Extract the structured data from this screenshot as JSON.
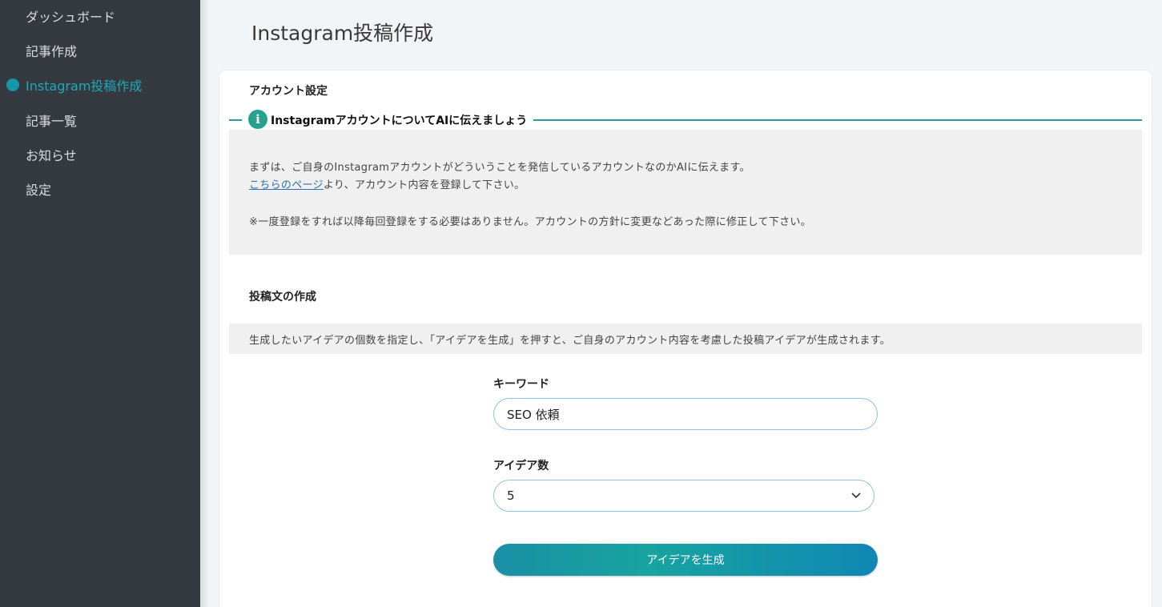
{
  "sidebar": {
    "items": [
      {
        "label": "ダッシュボード"
      },
      {
        "label": "記事作成"
      },
      {
        "label": "Instagram投稿作成"
      },
      {
        "label": "記事一覧"
      },
      {
        "label": "お知らせ"
      },
      {
        "label": "設定"
      }
    ],
    "active_color": "#1fa9b8",
    "background": "#343a40"
  },
  "page": {
    "title": "Instagram投稿作成"
  },
  "account_settings": {
    "heading": "アカウント設定",
    "info_title": "InstagramアカウントについてAIに伝えましょう",
    "info_icon": "info-icon",
    "line1": "まずは、ご自身のInstagramアカウントがどういうことを発信しているアカウントなのかAIに伝えます。",
    "link_text": "こちらのページ",
    "line2_rest": "より、アカウント内容を登録して下さい。",
    "note": "※一度登録をすれば以降毎回登録をする必要はありません。アカウントの方針に変更などあった際に修正して下さい。"
  },
  "post_creation": {
    "heading": "投稿文の作成",
    "hint": "生成したいアイデアの個数を指定し、「アイデアを生成」を押すと、ご自身のアカウント内容を考慮した投稿アイデアが生成されます。",
    "keyword_label": "キーワード",
    "keyword_value": "SEO 依頼",
    "idea_count_label": "アイデア数",
    "idea_count_value": "5",
    "generate_button": "アイデアを生成"
  },
  "colors": {
    "accent": "#1597a8",
    "button_gradient_start": "#1a8fa6",
    "button_gradient_end": "#1187b5"
  }
}
